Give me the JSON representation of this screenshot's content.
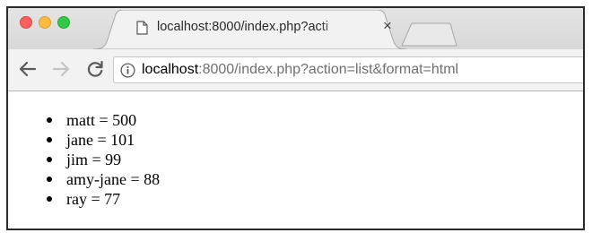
{
  "browser": {
    "tab": {
      "title": "localhost:8000/index.php?acti",
      "favicon": "page-icon",
      "close_label": "×"
    },
    "toolbar": {
      "back": "arrow-left-icon",
      "forward": "arrow-right-icon",
      "reload": "reload-icon",
      "url_host": "localhost",
      "url_rest": ":8000/index.php?action=list&format=html",
      "security": "info-icon"
    }
  },
  "content": {
    "items": [
      {
        "name": "matt",
        "value": 500,
        "text": "matt = 500"
      },
      {
        "name": "jane",
        "value": 101,
        "text": "jane = 101"
      },
      {
        "name": "jim",
        "value": 99,
        "text": "jim = 99"
      },
      {
        "name": "amy-jane",
        "value": 88,
        "text": "amy-jane = 88"
      },
      {
        "name": "ray",
        "value": 77,
        "text": "ray = 77"
      }
    ]
  },
  "colors": {
    "close": "#fc605c",
    "minimize": "#fdbc40",
    "maximize": "#34c84a"
  }
}
